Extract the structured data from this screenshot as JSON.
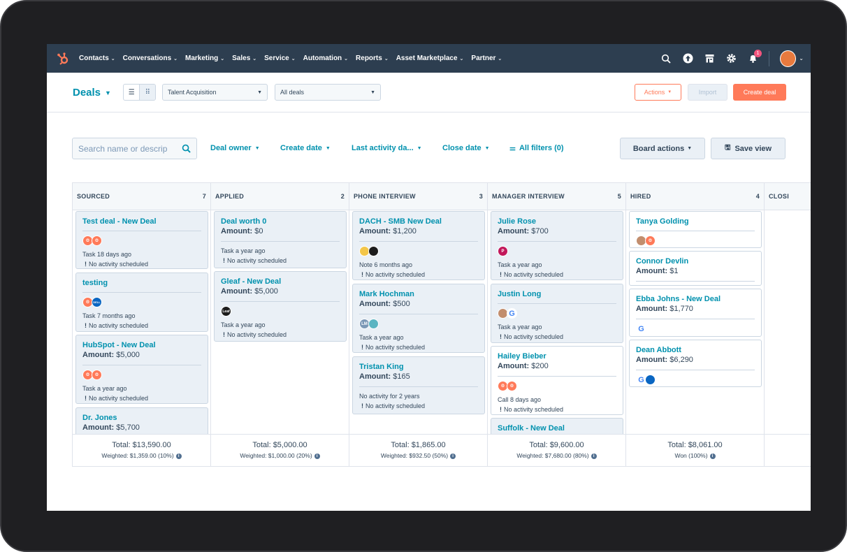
{
  "nav": {
    "items": [
      {
        "label": "Contacts"
      },
      {
        "label": "Conversations"
      },
      {
        "label": "Marketing"
      },
      {
        "label": "Sales"
      },
      {
        "label": "Service"
      },
      {
        "label": "Automation"
      },
      {
        "label": "Reports"
      },
      {
        "label": "Asset Marketplace"
      },
      {
        "label": "Partner"
      }
    ],
    "notification_count": "1"
  },
  "header": {
    "title": "Deals",
    "pipeline_select": "Talent Acquisition",
    "view_select": "All deals",
    "actions_label": "Actions",
    "import_label": "Import",
    "create_label": "Create deal"
  },
  "filters": {
    "search_placeholder": "Search name or descrip",
    "deal_owner": "Deal owner",
    "create_date": "Create date",
    "last_activity": "Last activity da...",
    "close_date": "Close date",
    "all_filters": "All filters (0)",
    "board_actions": "Board actions",
    "save_view": "Save view"
  },
  "columns": [
    {
      "name": "SOURCED",
      "count": "7",
      "total": "Total: $13,590.00",
      "weighted": "Weighted: $1,359.00 (10%)"
    },
    {
      "name": "APPLIED",
      "count": "2",
      "total": "Total: $5,000.00",
      "weighted": "Weighted: $1,000.00 (20%)"
    },
    {
      "name": "PHONE INTERVIEW",
      "count": "3",
      "total": "Total: $1,865.00",
      "weighted": "Weighted: $932.50 (50%)"
    },
    {
      "name": "MANAGER INTERVIEW",
      "count": "5",
      "total": "Total: $9,600.00",
      "weighted": "Weighted: $7,680.00 (80%)"
    },
    {
      "name": "HIRED",
      "count": "4",
      "total": "Total: $8,061.00",
      "weighted": "Won (100%)"
    },
    {
      "name": "CLOSI"
    }
  ],
  "cards": {
    "sourced": [
      {
        "title": "Test deal - New Deal",
        "task": "Task 18 days ago",
        "noact": "No activity scheduled"
      },
      {
        "title": "testing",
        "task": "Task 7 months ago",
        "noact": "No activity scheduled"
      },
      {
        "title": "HubSpot - New Deal",
        "amount_label": "Amount:",
        "amount": "$5,000",
        "task": "Task a year ago",
        "noact": "No activity scheduled"
      },
      {
        "title": "Dr. Jones",
        "amount_label": "Amount:",
        "amount": "$5,700"
      }
    ],
    "applied": [
      {
        "title": "Deal worth 0",
        "amount_label": "Amount:",
        "amount": "$0",
        "task": "Task a year ago",
        "noact": "No activity scheduled"
      },
      {
        "title": "Gleaf - New Deal",
        "amount_label": "Amount:",
        "amount": "$5,000",
        "task": "Task a year ago",
        "noact": "No activity scheduled"
      }
    ],
    "phone": [
      {
        "title": "DACH - SMB New Deal",
        "amount_label": "Amount:",
        "amount": "$1,200",
        "task": "Note 6 months ago",
        "noact": "No activity scheduled"
      },
      {
        "title": "Mark Hochman",
        "amount_label": "Amount:",
        "amount": "$500",
        "task": "Task a year ago",
        "noact": "No activity scheduled"
      },
      {
        "title": "Tristan King",
        "amount_label": "Amount:",
        "amount": "$165",
        "task": "No activity for 2 years",
        "noact": "No activity scheduled"
      }
    ],
    "manager": [
      {
        "title": "Julie Rose",
        "amount_label": "Amount:",
        "amount": "$700",
        "task": "Task a year ago",
        "noact": "No activity scheduled"
      },
      {
        "title": "Justin Long",
        "task": "Task a year ago",
        "noact": "No activity scheduled"
      },
      {
        "title": "Hailey Bieber",
        "amount_label": "Amount:",
        "amount": "$200",
        "task": "Call 8 days ago",
        "noact": "No activity scheduled"
      },
      {
        "title": "Suffolk - New Deal"
      }
    ],
    "hired": [
      {
        "title": "Tanya Golding"
      },
      {
        "title": "Connor Devlin",
        "amount_label": "Amount:",
        "amount": "$1"
      },
      {
        "title": "Ebba Johns - New Deal",
        "amount_label": "Amount:",
        "amount": "$1,770"
      },
      {
        "title": "Dean Abbott",
        "amount_label": "Amount:",
        "amount": "$6,290"
      }
    ]
  },
  "avatar_text": {
    "dell": "DELL",
    "lm": "LM",
    "leaf": "Leaf",
    "p": "P",
    "g": "G"
  },
  "colors": {
    "nav_bg": "#2d3e50",
    "link": "#0091ae",
    "primary": "#ff7a59",
    "card_bg": "#eaf0f6"
  }
}
